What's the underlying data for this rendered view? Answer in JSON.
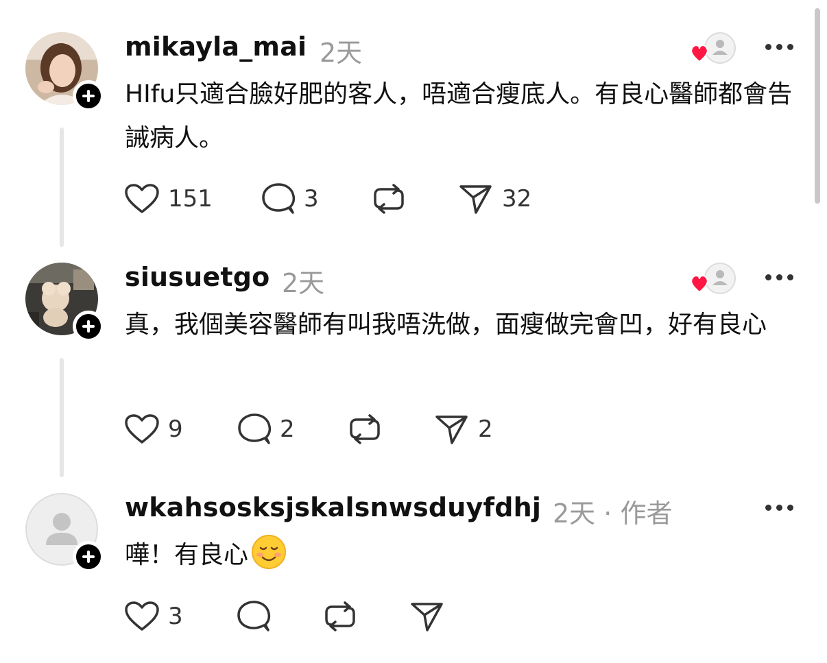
{
  "comments": [
    {
      "username": "mikayla_mai",
      "time": "2天",
      "text": "HIfu只適合臉好肥的客人，唔適合瘦底人。有良心醫師都會告誡病人。",
      "likes": "151",
      "replies": "3",
      "reposts": "",
      "shares": "32",
      "liked_by_author": true,
      "avatar": "photo-woman"
    },
    {
      "username": "siusuetgo",
      "time": "2天",
      "text": "真，我個美容醫師有叫我唔洗做，面瘦做完會凹，好有良心",
      "likes": "9",
      "replies": "2",
      "reposts": "",
      "shares": "2",
      "liked_by_author": true,
      "avatar": "photo-plush-toy"
    },
    {
      "username": "wkahsosksjskalsnwsduyfdhj",
      "time": "2天",
      "separator": "·",
      "author_tag": "作者",
      "text": "嘩！有良心",
      "emoji": "smiling-face-emoji",
      "likes": "3",
      "replies": "",
      "reposts": "",
      "shares": "",
      "avatar": "default-avatar"
    }
  ],
  "colors": {
    "text": "#111111",
    "muted": "#9a9a9a",
    "heart": "#ff1744",
    "icon": "#333333"
  }
}
